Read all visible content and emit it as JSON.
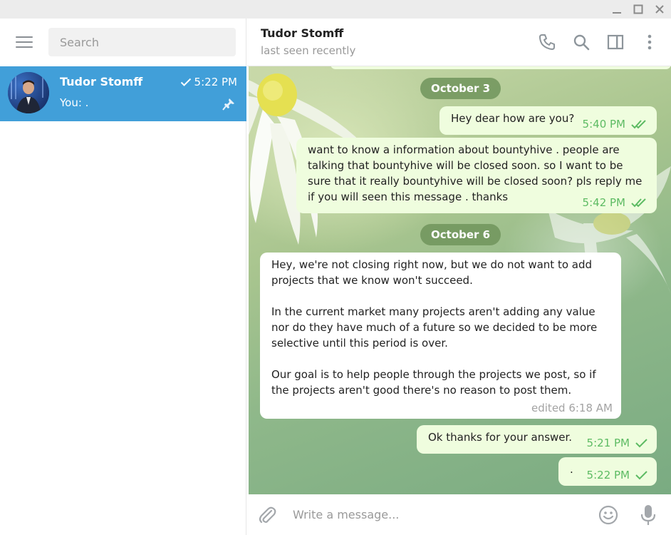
{
  "window": {
    "minimize_icon": "minimize-icon",
    "maximize_icon": "maximize-icon",
    "close_icon": "close-icon"
  },
  "sidebar": {
    "search_placeholder": "Search",
    "chats": [
      {
        "name": "Tudor Stomff",
        "time": "5:22 PM",
        "preview": "You: .",
        "pinned": true,
        "read": true
      }
    ]
  },
  "header": {
    "name": "Tudor Stomff",
    "status": "last seen recently"
  },
  "messages": {
    "date1": "October 3",
    "m1": {
      "text": "Hey dear how are you?",
      "time": "5:40 PM"
    },
    "m2": {
      "lines": [
        "want to know a information about bountyhive . people are",
        "talking that bountyhive will be closed soon. so I want to be",
        "sure that it really bountyhive will be closed soon? pls reply me",
        "if you will seen this message . thanks"
      ],
      "time": "5:42 PM"
    },
    "date2": "October 6",
    "m3": {
      "p1": [
        "Hey, we're not closing right now, but we do not want to add",
        "projects that we know won't succeed."
      ],
      "p2": [
        "In the current market many projects aren't adding any value",
        "nor do they have much of a future so we decided to be more",
        "selective until this period is over."
      ],
      "p3": [
        "Our goal is to help people through the projects we post, so if",
        "the projects aren't good there's no reason to post them."
      ],
      "time": "edited 6:18 AM"
    },
    "m4": {
      "text": "Ok thanks for your answer.",
      "time": "5:21 PM"
    },
    "m5": {
      "text": ".",
      "time": "5:22 PM"
    }
  },
  "composer": {
    "placeholder": "Write a message..."
  },
  "colors": {
    "selected_chat": "#419fd9",
    "outgoing_bubble": "#effdde",
    "check": "#5dbb63",
    "date_pill": "#70945c"
  }
}
